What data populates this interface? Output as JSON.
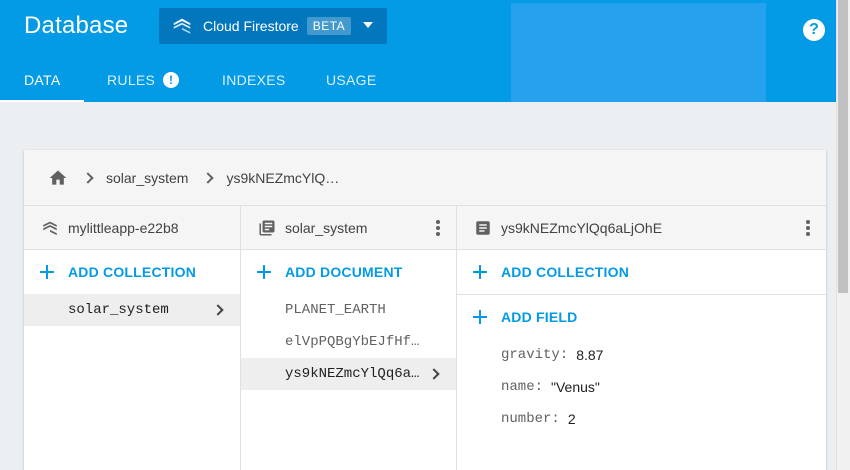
{
  "header": {
    "title": "Database",
    "db_selector": {
      "label": "Cloud Firestore",
      "badge": "BETA"
    },
    "help_glyph": "?",
    "tabs": [
      {
        "label": "DATA",
        "active": true
      },
      {
        "label": "RULES",
        "badge": "!"
      },
      {
        "label": "INDEXES"
      },
      {
        "label": "USAGE"
      }
    ]
  },
  "breadcrumb": {
    "items": [
      "solar_system",
      "ys9kNEZmcYlQ…"
    ]
  },
  "columns": {
    "root": {
      "title": "mylittleapp-e22b8",
      "add_label": "ADD COLLECTION",
      "items": [
        {
          "label": "solar_system",
          "selected": true
        }
      ]
    },
    "collection": {
      "title": "solar_system",
      "add_label": "ADD DOCUMENT",
      "items": [
        {
          "label": "PLANET_EARTH"
        },
        {
          "label": "elVpPQBgYbEJfHf…"
        },
        {
          "label": "ys9kNEZmcYlQq6a…",
          "selected": true
        }
      ]
    },
    "document": {
      "title": "ys9kNEZmcYlQq6aLjOhE",
      "add_collection_label": "ADD COLLECTION",
      "add_field_label": "ADD FIELD",
      "fields": [
        {
          "key": "gravity:",
          "value": "8.87"
        },
        {
          "key": "name:",
          "value": "\"Venus\""
        },
        {
          "key": "number:",
          "value": "2"
        }
      ]
    }
  },
  "colors": {
    "primary": "#039be5",
    "primary_dark": "#0277bd",
    "background": "#eceff1"
  }
}
